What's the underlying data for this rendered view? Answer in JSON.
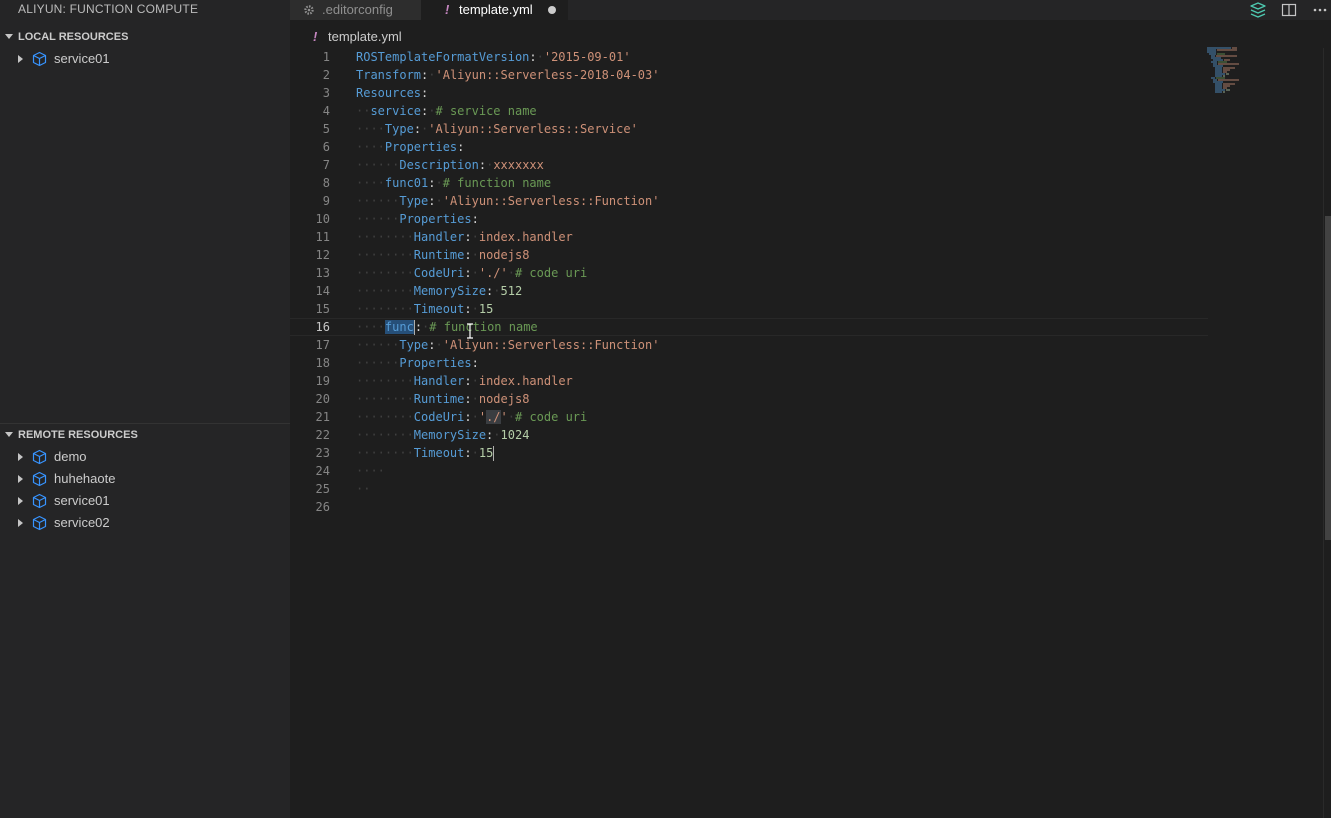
{
  "sidebar": {
    "title": "ALIYUN: FUNCTION COMPUTE",
    "local": {
      "header": "LOCAL RESOURCES",
      "items": [
        {
          "label": "service01"
        }
      ]
    },
    "remote": {
      "header": "REMOTE RESOURCES",
      "items": [
        {
          "label": "demo"
        },
        {
          "label": "huhehaote"
        },
        {
          "label": "service01"
        },
        {
          "label": "service02"
        }
      ]
    }
  },
  "tabs": [
    {
      "label": ".editorconfig",
      "icon": "gear-icon",
      "active": false
    },
    {
      "label": "template.yml",
      "icon": "yaml-exclamation-icon",
      "active": true,
      "dirty": true
    }
  ],
  "breadcrumb": {
    "icon": "!",
    "file": "template.yml"
  },
  "editor": {
    "current_line": 16,
    "lines": [
      {
        "n": "1"
      },
      {
        "n": "2"
      },
      {
        "n": "3"
      },
      {
        "n": "4"
      },
      {
        "n": "5"
      },
      {
        "n": "6"
      },
      {
        "n": "7"
      },
      {
        "n": "8"
      },
      {
        "n": "9"
      },
      {
        "n": "10"
      },
      {
        "n": "11"
      },
      {
        "n": "12"
      },
      {
        "n": "13"
      },
      {
        "n": "14"
      },
      {
        "n": "15"
      },
      {
        "n": "16"
      },
      {
        "n": "17"
      },
      {
        "n": "18"
      },
      {
        "n": "19"
      },
      {
        "n": "20"
      },
      {
        "n": "21"
      },
      {
        "n": "22"
      },
      {
        "n": "23"
      },
      {
        "n": "24"
      },
      {
        "n": "25"
      },
      {
        "n": "26"
      }
    ],
    "code": {
      "l1_key": "ROSTemplateFormatVersion",
      "l1_val": "'2015-09-01'",
      "l2_key": "Transform",
      "l2_val": "'Aliyun::Serverless-2018-04-03'",
      "l3_key": "Resources",
      "l4_key": "service",
      "l4_comment": "# service name",
      "l5_key": "Type",
      "l5_val": "'Aliyun::Serverless::Service'",
      "l6_key": "Properties",
      "l7_key": "Description",
      "l7_val": "xxxxxxx",
      "l8_key": "func01",
      "l8_comment": "# function name",
      "l9_key": "Type",
      "l9_val": "'Aliyun::Serverless::Function'",
      "l10_key": "Properties",
      "l11_key": "Handler",
      "l11_val": "index.handler",
      "l12_key": "Runtime",
      "l12_val": "nodejs8",
      "l13_key": "CodeUri",
      "l13_val": "'./'",
      "l13_comment": "# code uri",
      "l14_key": "MemorySize",
      "l14_val": "512",
      "l15_key": "Timeout",
      "l15_val": "15",
      "l16_key": "func",
      "l16_comment": "# function name",
      "l17_key": "Type",
      "l17_val": "'Aliyun::Serverless::Function'",
      "l18_key": "Properties",
      "l19_key": "Handler",
      "l19_val": "index.handler",
      "l20_key": "Runtime",
      "l20_val": "nodejs8",
      "l21_key": "CodeUri",
      "l21_val_q1": "'",
      "l21_val_sel": "./",
      "l21_val_q2": "'",
      "l21_comment": "# code uri",
      "l22_key": "MemorySize",
      "l22_val": "1024",
      "l23_key": "Timeout",
      "l23_val": "15"
    }
  },
  "colors": {
    "keyword": "#569cd6",
    "string": "#ce9178",
    "number": "#b5cea8",
    "comment": "#6a9955",
    "resource_icon": "#3794ff"
  }
}
